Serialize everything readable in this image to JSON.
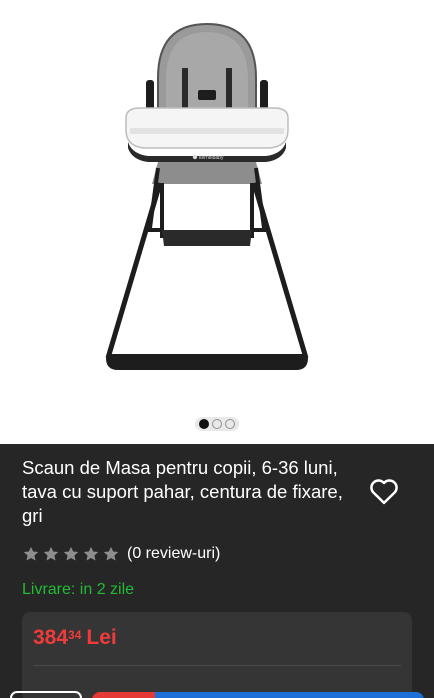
{
  "product": {
    "title": "Scaun de Masa pentru copii, 6-36 luni, tava cu suport pahar, centura de fixare, gri",
    "image_icon": "high-chair-image",
    "brand_logo_text": "kernelbaby"
  },
  "gallery": {
    "image_count": 3,
    "active_index": 0
  },
  "rating": {
    "stars_filled": 0,
    "stars_total": 5,
    "review_text": "(0 review-uri)"
  },
  "delivery": {
    "text": "Livrare: in 2 zile"
  },
  "price": {
    "integer": "384",
    "cents": "34",
    "currency": "Lei"
  },
  "colors": {
    "price": "#ef3b3b",
    "delivery": "#22bb33",
    "panel_bg": "#262626",
    "card_bg": "#353535",
    "cta_red": "#e53935",
    "cta_blue": "#1f6fd8"
  },
  "icons": {
    "favorite": "heart-outline-icon",
    "star": "star-icon"
  }
}
